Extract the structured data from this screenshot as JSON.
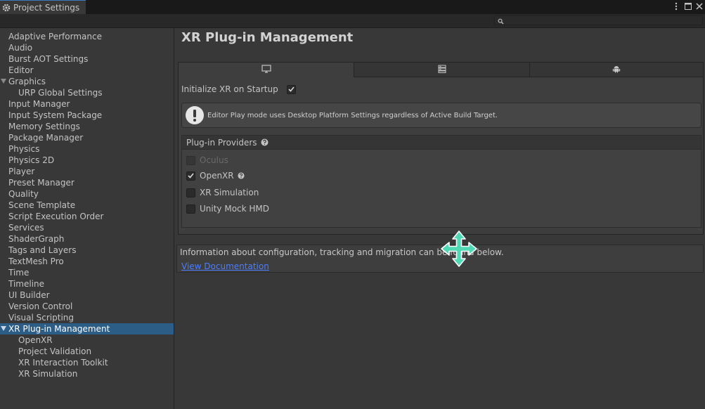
{
  "window": {
    "title": "Project Settings"
  },
  "search": {
    "placeholder": "",
    "value": ""
  },
  "sidebar": {
    "items": [
      {
        "label": "Adaptive Performance",
        "level": 0
      },
      {
        "label": "Audio",
        "level": 0
      },
      {
        "label": "Burst AOT Settings",
        "level": 0
      },
      {
        "label": "Editor",
        "level": 0
      },
      {
        "label": "Graphics",
        "level": 0,
        "expanded": true
      },
      {
        "label": "URP Global Settings",
        "level": 1
      },
      {
        "label": "Input Manager",
        "level": 0
      },
      {
        "label": "Input System Package",
        "level": 0
      },
      {
        "label": "Memory Settings",
        "level": 0
      },
      {
        "label": "Package Manager",
        "level": 0
      },
      {
        "label": "Physics",
        "level": 0
      },
      {
        "label": "Physics 2D",
        "level": 0
      },
      {
        "label": "Player",
        "level": 0
      },
      {
        "label": "Preset Manager",
        "level": 0
      },
      {
        "label": "Quality",
        "level": 0
      },
      {
        "label": "Scene Template",
        "level": 0
      },
      {
        "label": "Script Execution Order",
        "level": 0
      },
      {
        "label": "Services",
        "level": 0
      },
      {
        "label": "ShaderGraph",
        "level": 0
      },
      {
        "label": "Tags and Layers",
        "level": 0
      },
      {
        "label": "TextMesh Pro",
        "level": 0
      },
      {
        "label": "Time",
        "level": 0
      },
      {
        "label": "Timeline",
        "level": 0
      },
      {
        "label": "UI Builder",
        "level": 0
      },
      {
        "label": "Version Control",
        "level": 0
      },
      {
        "label": "Visual Scripting",
        "level": 0
      },
      {
        "label": "XR Plug-in Management",
        "level": 0,
        "expanded": true,
        "selected": true
      },
      {
        "label": "OpenXR",
        "level": 1
      },
      {
        "label": "Project Validation",
        "level": 1
      },
      {
        "label": "XR Interaction Toolkit",
        "level": 1
      },
      {
        "label": "XR Simulation",
        "level": 1
      }
    ]
  },
  "main": {
    "title": "XR Plug-in Management",
    "platform_tabs": [
      {
        "icon": "desktop-monitor-icon",
        "active": true
      },
      {
        "icon": "dedicated-server-icon",
        "active": false
      },
      {
        "icon": "android-icon",
        "active": false
      }
    ],
    "init_on_startup": {
      "label": "Initialize XR on Startup",
      "checked": true
    },
    "help_box": {
      "icon": "warning-icon",
      "text": "Editor Play mode uses Desktop Platform Settings regardless of Active Build Target."
    },
    "providers": {
      "header": "Plug-in Providers",
      "items": [
        {
          "label": "Oculus",
          "checked": false,
          "disabled": true
        },
        {
          "label": "OpenXR",
          "checked": true,
          "disabled": false,
          "help": true
        },
        {
          "label": "XR Simulation",
          "checked": false,
          "disabled": false
        },
        {
          "label": "Unity Mock HMD",
          "checked": false,
          "disabled": false
        }
      ]
    },
    "info": {
      "text": "Information about configuration, tracking and migration can be found below.",
      "link": "View Documentation"
    }
  },
  "colors": {
    "background": "#383838",
    "selection": "#2c5d87",
    "link": "#4c7eff",
    "cursor": "#4fd9b5"
  }
}
